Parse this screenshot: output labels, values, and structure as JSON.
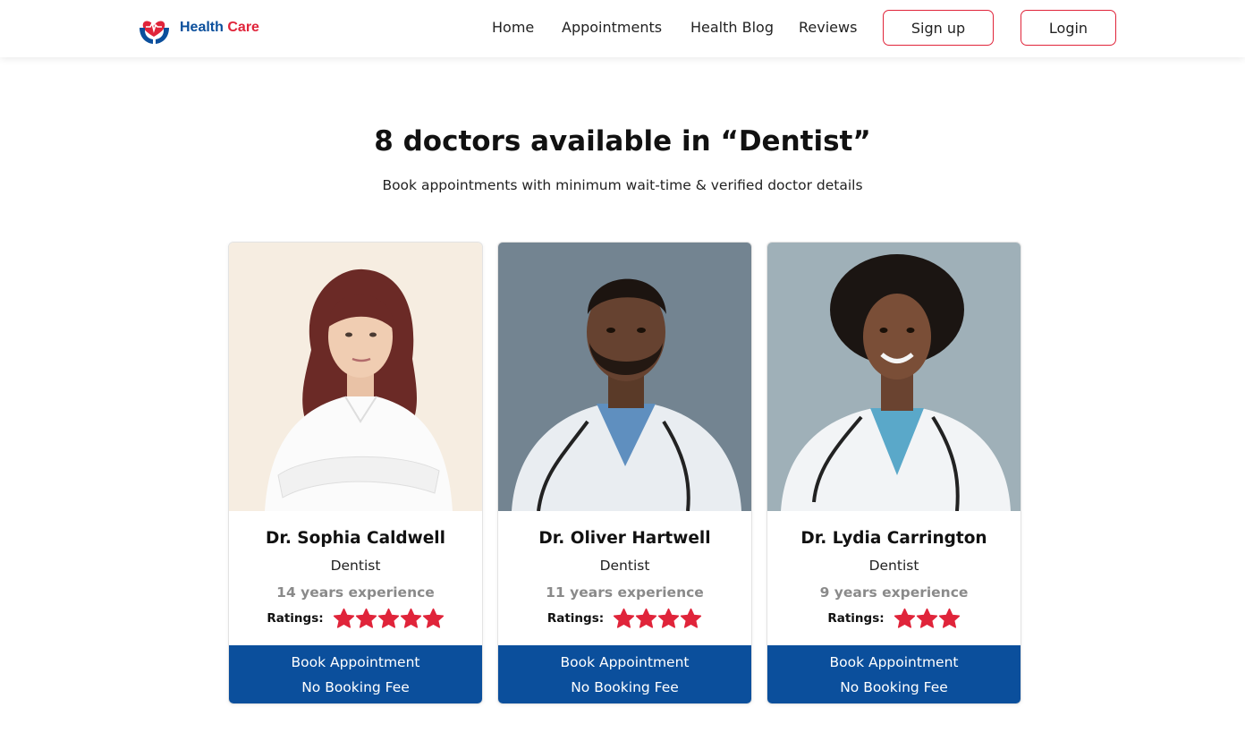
{
  "brand": {
    "word1": "Health",
    "word2": "Care",
    "blue": "#0b4f9c",
    "red": "#e0243a"
  },
  "nav": {
    "links": [
      "Home",
      "Appointments",
      "Health Blog",
      "Reviews"
    ],
    "signup": "Sign up",
    "login": "Login"
  },
  "page": {
    "heading": "8 doctors available in “Dentist”",
    "subheading": "Book appointments with minimum wait-time & verified doctor details"
  },
  "doctors": [
    {
      "name": "Dr. Sophia Caldwell",
      "specialty": "Dentist",
      "experience": "14 years experience",
      "ratings_label": "Ratings:",
      "stars": 5,
      "book_label": "Book Appointment",
      "fee_label": "No Booking Fee"
    },
    {
      "name": "Dr. Oliver Hartwell",
      "specialty": "Dentist",
      "experience": "11 years experience",
      "ratings_label": "Ratings:",
      "stars": 4,
      "book_label": "Book Appointment",
      "fee_label": "No Booking Fee"
    },
    {
      "name": "Dr. Lydia Carrington",
      "specialty": "Dentist",
      "experience": "9 years experience",
      "ratings_label": "Ratings:",
      "stars": 3,
      "book_label": "Book Appointment",
      "fee_label": "No Booking Fee"
    }
  ],
  "icons": {
    "logo": "heart-hands-logo-icon",
    "star": "star-icon"
  },
  "colors": {
    "accent_blue": "#0b4f9c",
    "accent_red": "#e0243a",
    "star": "#e0243a",
    "muted": "#8a8a8a"
  }
}
